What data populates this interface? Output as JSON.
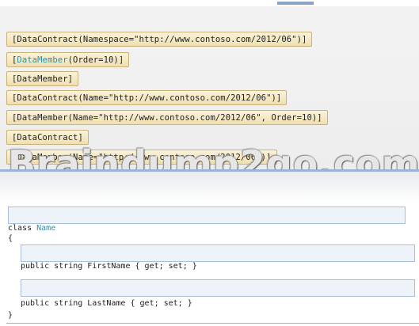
{
  "attribute_tiles": [
    {
      "kind": "plain",
      "text": "[DataContract(Namespace=\"http://www.contoso.com/2012/06\")]"
    },
    {
      "kind": "split",
      "open": "[",
      "keyword": "DataMember",
      "rest": "(Order=10)]"
    },
    {
      "kind": "plain",
      "text": "[DataMember]"
    },
    {
      "kind": "plain",
      "text": "[DataContract(Name=\"http://www.contoso.com/2012/06\")]"
    },
    {
      "kind": "plain",
      "text": "[DataMember(Name=\"http://www.contoso.com/2012/06\", Order=10)]"
    },
    {
      "kind": "plain",
      "text": "[DataContract]"
    },
    {
      "kind": "plain",
      "text": "[DataMember(Name=\"http://www.contoso.com/2012/06\")]"
    }
  ],
  "watermark": "Braindump2go.com",
  "code": {
    "class_keyword": "class",
    "class_name": "Name",
    "open_brace": "{",
    "first_property": "public string FirstName { get; set; }",
    "last_property": "public string LastName { get; set; }",
    "close_brace": "}"
  }
}
